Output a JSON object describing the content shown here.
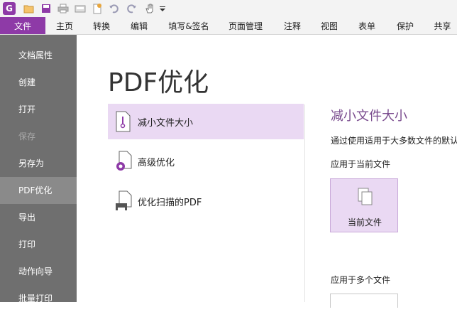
{
  "quick_access": {
    "logo_letter": "G",
    "icons": [
      "app-logo-icon",
      "open-folder-icon",
      "save-icon",
      "print-icon",
      "scan-icon",
      "new-icon",
      "undo-icon",
      "redo-icon",
      "hand-tool-icon",
      "customize-dropdown-icon"
    ]
  },
  "ribbon": {
    "tabs": [
      "文件",
      "主页",
      "转换",
      "编辑",
      "填写&签名",
      "页面管理",
      "注释",
      "视图",
      "表单",
      "保护",
      "共享"
    ],
    "active_tab": "文件",
    "accent_color": "#8e3aa7"
  },
  "leftnav": {
    "items": [
      {
        "label": "文档属性",
        "state": "normal"
      },
      {
        "label": "创建",
        "state": "normal"
      },
      {
        "label": "打开",
        "state": "normal"
      },
      {
        "label": "保存",
        "state": "disabled"
      },
      {
        "label": "另存为",
        "state": "normal"
      },
      {
        "label": "PDF优化",
        "state": "active"
      },
      {
        "label": "导出",
        "state": "normal"
      },
      {
        "label": "打印",
        "state": "normal"
      },
      {
        "label": "动作向导",
        "state": "normal"
      },
      {
        "label": "批量打印",
        "state": "normal"
      }
    ]
  },
  "main": {
    "title": "PDF优化",
    "options": [
      {
        "label": "减小文件大小",
        "icon": "reduce-size-icon",
        "selected": true
      },
      {
        "label": "高级优化",
        "icon": "advanced-optimize-icon",
        "selected": false
      },
      {
        "label": "优化扫描的PDF",
        "icon": "optimize-scanned-icon",
        "selected": false
      }
    ],
    "detail": {
      "title": "减小文件大小",
      "description": "通过使用适用于大多数文件的默认",
      "apply_current_label": "应用于当前文件",
      "current_button_label": "当前文件",
      "apply_multiple_label": "应用于多个文件"
    }
  }
}
